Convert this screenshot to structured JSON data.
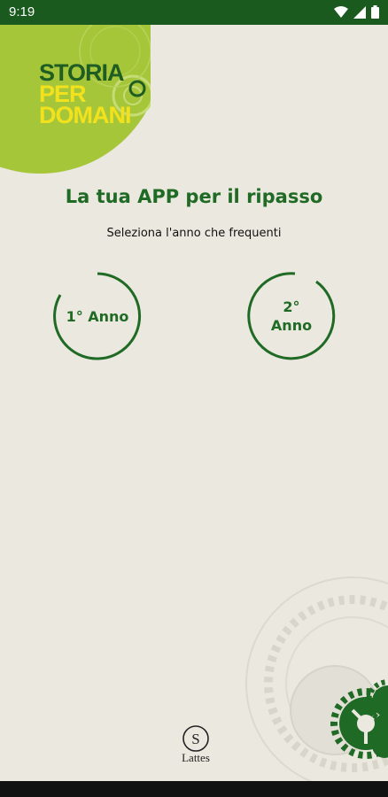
{
  "status": {
    "time": "9:19"
  },
  "logo": {
    "line1": "STORIA",
    "line2": "PER",
    "line3": "DOMANI"
  },
  "header": {
    "title": "La tua APP per il ripasso",
    "subtitle": "Seleziona l'anno che frequenti"
  },
  "years": [
    {
      "label": "1° Anno"
    },
    {
      "label": "2° Anno"
    }
  ],
  "brand": {
    "name": "Lattes"
  },
  "colors": {
    "accent": "#1f6a24",
    "background": "#ebe8df",
    "statusbar": "#1a5a1e",
    "logo_yellow": "#f1e21d",
    "logo_lime": "#a6c63a"
  }
}
